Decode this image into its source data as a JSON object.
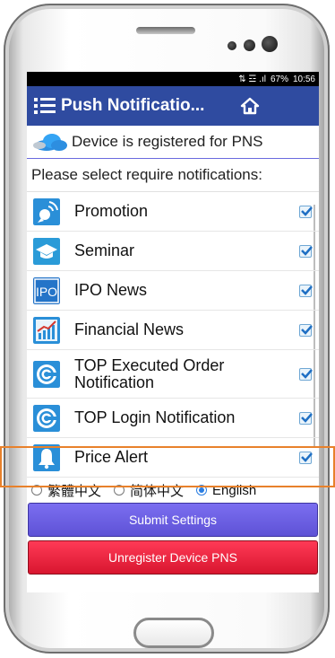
{
  "status_bar": {
    "icons": "⇅ ☲ .ıl",
    "battery": "67%",
    "time": "10:56"
  },
  "app_bar": {
    "title": "Push Notificatio...",
    "menu_icon": "menu-icon",
    "home_icon": "home-icon",
    "color": "#2f4ba0"
  },
  "registration": {
    "text": "Device is registered for PNS",
    "icon": "cloud-icon"
  },
  "prompt": "Please select require notifications:",
  "notifications": [
    {
      "label": "Promotion",
      "icon": "satellite-icon",
      "checked": true
    },
    {
      "label": "Seminar",
      "icon": "graduation-cap-icon",
      "checked": true
    },
    {
      "label": "IPO News",
      "icon": "ipo-icon",
      "icon_text": "IPO",
      "checked": true
    },
    {
      "label": "Financial News",
      "icon": "chart-icon",
      "checked": true
    },
    {
      "label": "TOP Executed Order Notification",
      "icon": "target-icon",
      "checked": true
    },
    {
      "label": "TOP Login Notification",
      "icon": "target-icon",
      "checked": true
    },
    {
      "label": "Price Alert",
      "icon": "bell-icon",
      "checked": true
    }
  ],
  "languages": [
    {
      "label": "繁體中文",
      "selected": false
    },
    {
      "label": "简体中文",
      "selected": false
    },
    {
      "label": "English",
      "selected": true
    }
  ],
  "buttons": {
    "submit": "Submit Settings",
    "unregister": "Unregister Device PNS"
  },
  "colors": {
    "highlight": "#e8812b",
    "submit": "#6b5fe6",
    "unregister": "#f0223f"
  }
}
